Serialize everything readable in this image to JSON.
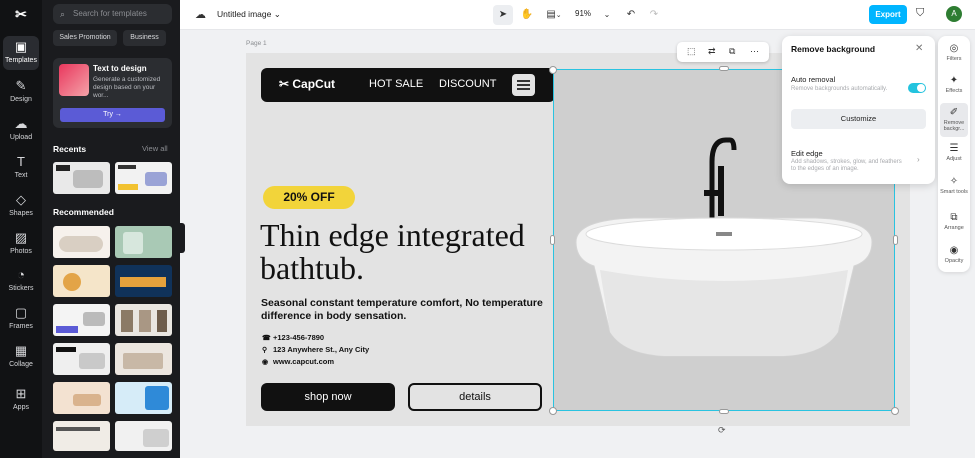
{
  "app": {
    "title": "Untitled image",
    "zoom": "91%",
    "export_label": "Export",
    "user_initial": "A"
  },
  "rail": [
    {
      "label": "Templates",
      "icon": "▣",
      "icon_name": "templates-icon"
    },
    {
      "label": "Design",
      "icon": "✎",
      "icon_name": "design-icon"
    },
    {
      "label": "Upload",
      "icon": "☁",
      "icon_name": "upload-icon"
    },
    {
      "label": "Text",
      "icon": "T",
      "icon_name": "text-icon"
    },
    {
      "label": "Shapes",
      "icon": "◇",
      "icon_name": "shapes-icon"
    },
    {
      "label": "Photos",
      "icon": "▨",
      "icon_name": "photos-icon"
    },
    {
      "label": "Stickers",
      "icon": "◔",
      "icon_name": "stickers-icon"
    },
    {
      "label": "Frames",
      "icon": "▢",
      "icon_name": "frames-icon"
    },
    {
      "label": "Collage",
      "icon": "▦",
      "icon_name": "collage-icon"
    },
    {
      "label": "Apps",
      "icon": "⊞",
      "icon_name": "apps-icon"
    }
  ],
  "panel": {
    "search_placeholder": "Search for templates",
    "chips": [
      "Sales Promotion",
      "Business"
    ],
    "promo": {
      "title": "Text to design",
      "desc": "Generate a customized design based on your wor...",
      "try_label": "Try →"
    },
    "recents_label": "Recents",
    "view_all_label": "View all",
    "recommended_label": "Recommended"
  },
  "canvas": {
    "page_label": "Page 1",
    "brand": "CapCut",
    "nav_links": [
      "HOT SALE",
      "DISCOUNT"
    ],
    "discount": "20% OFF",
    "headline": "Thin edge integrated bathtub.",
    "subhead": "Seasonal constant temperature comfort, No temperature difference in body sensation.",
    "phone": "+123-456-7890",
    "address": "123 Anywhere St., Any City",
    "website": "www.capcut.com",
    "shop_label": "shop now",
    "details_label": "details"
  },
  "remove_bg": {
    "title": "Remove background",
    "auto_label": "Auto removal",
    "auto_desc": "Remove backgrounds automatically.",
    "auto_on": true,
    "customize_label": "Customize",
    "edge_label": "Edit edge",
    "edge_desc": "Add shadows, strokes, glow, and feathers to the edges of an image."
  },
  "tools": [
    {
      "label": "Filters",
      "icon": "◎",
      "icon_name": "filters-icon"
    },
    {
      "label": "Effects",
      "icon": "✦",
      "icon_name": "effects-icon"
    },
    {
      "label": "Remove backgr...",
      "icon": "✐",
      "icon_name": "remove-background-icon"
    },
    {
      "label": "Adjust",
      "icon": "☰",
      "icon_name": "adjust-icon"
    },
    {
      "label": "Smart tools",
      "icon": "✧",
      "icon_name": "smart-tools-icon"
    },
    {
      "label": "Arrange",
      "icon": "⧉",
      "icon_name": "arrange-icon"
    },
    {
      "label": "Opacity",
      "icon": "◉",
      "icon_name": "opacity-icon"
    }
  ],
  "colors": {
    "accent": "#00b5ff",
    "selection": "#2ac3e0",
    "pill": "#f2d43a"
  }
}
